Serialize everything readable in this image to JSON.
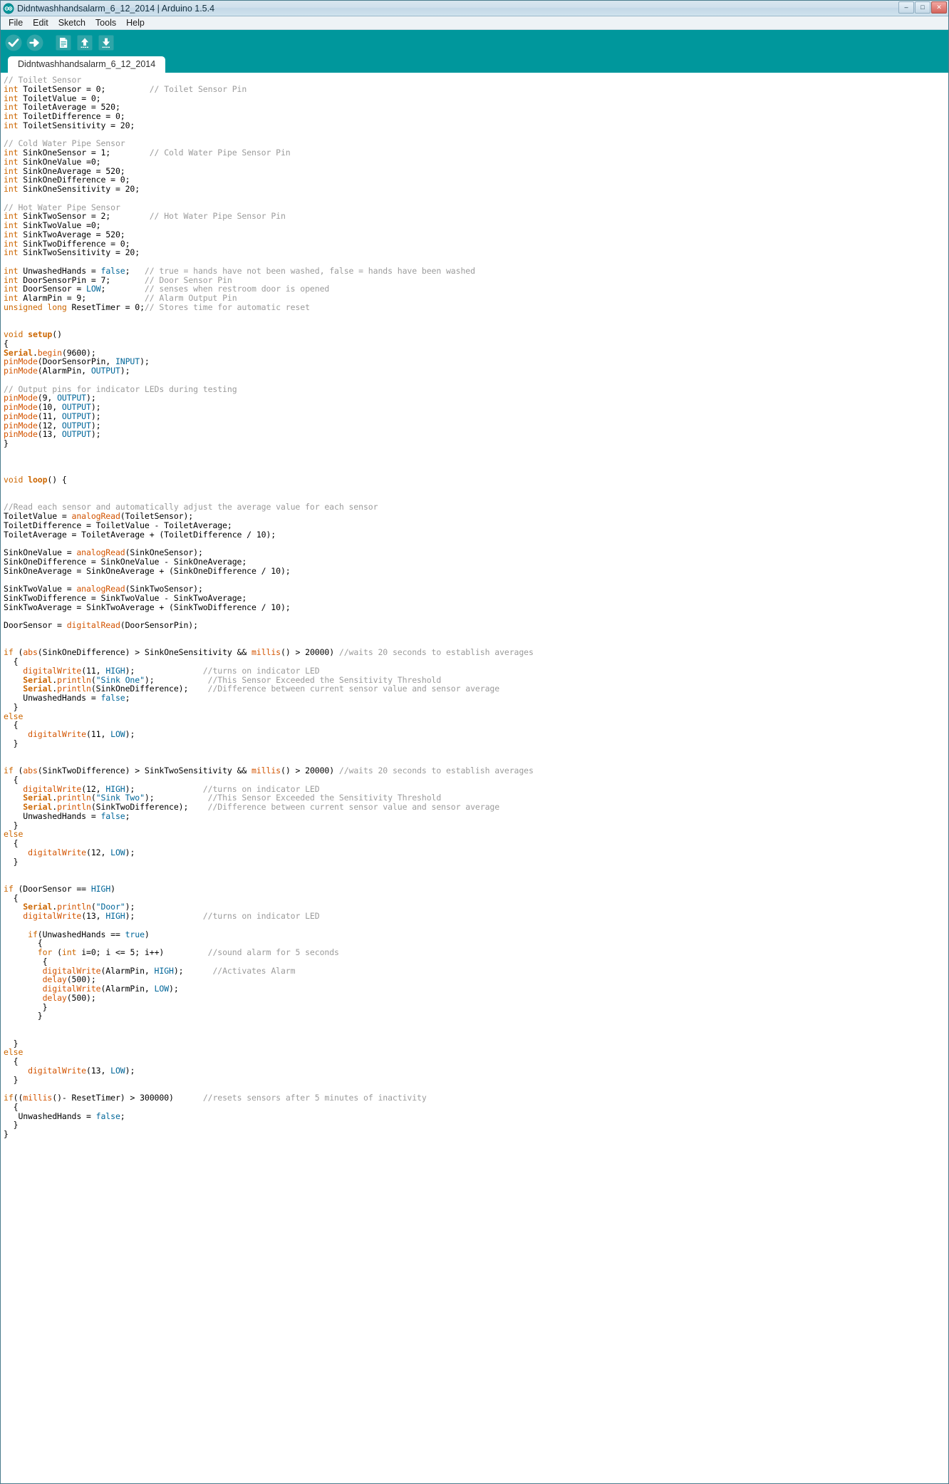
{
  "window": {
    "title": "Didntwashhandsalarm_6_12_2014 | Arduino 1.5.4",
    "app_icon": "arduino-infinity-icon",
    "minimize_label": "–",
    "maximize_label": "□",
    "close_label": "✕",
    "accent_color": "#00979C",
    "titlebar_color": "#CFE0EC"
  },
  "menu": {
    "items": [
      {
        "label": "File"
      },
      {
        "label": "Edit"
      },
      {
        "label": "Sketch"
      },
      {
        "label": "Tools"
      },
      {
        "label": "Help"
      }
    ]
  },
  "toolbar": {
    "buttons": [
      {
        "name": "verify-button",
        "icon": "checkmark-icon",
        "label": "Verify"
      },
      {
        "name": "upload-button",
        "icon": "arrow-right-icon",
        "label": "Upload"
      },
      {
        "name": "new-button",
        "icon": "new-document-icon",
        "label": "New"
      },
      {
        "name": "open-button",
        "icon": "arrow-up-icon",
        "label": "Open"
      },
      {
        "name": "save-button",
        "icon": "arrow-down-icon",
        "label": "Save"
      }
    ]
  },
  "tabs": [
    {
      "label": "Didntwashhandsalarm_6_12_2014",
      "active": true
    }
  ],
  "editor": {
    "language": "arduino-c",
    "colors": {
      "comment": "#9B9B9B",
      "keyword": "#CC6600",
      "function": "#D35400",
      "literal": "#006699",
      "string": "#006699",
      "plain": "#000000"
    },
    "code_lines": [
      "// Toilet Sensor",
      "int ToiletSensor = 0;         // Toilet Sensor Pin",
      "int ToiletValue = 0;",
      "int ToiletAverage = 520;",
      "int ToiletDifference = 0;",
      "int ToiletSensitivity = 20;",
      "",
      "// Cold Water Pipe Sensor",
      "int SinkOneSensor = 1;        // Cold Water Pipe Sensor Pin",
      "int SinkOneValue =0;",
      "int SinkOneAverage = 520;",
      "int SinkOneDifference = 0;",
      "int SinkOneSensitivity = 20;",
      "",
      "// Hot Water Pipe Sensor",
      "int SinkTwoSensor = 2;        // Hot Water Pipe Sensor Pin",
      "int SinkTwoValue =0;",
      "int SinkTwoAverage = 520;",
      "int SinkTwoDifference = 0;",
      "int SinkTwoSensitivity = 20;",
      "",
      "int UnwashedHands = false;   // true = hands have not been washed, false = hands have been washed",
      "int DoorSensorPin = 7;       // Door Sensor Pin",
      "int DoorSensor = LOW;        // senses when restroom door is opened",
      "int AlarmPin = 9;            // Alarm Output Pin",
      "unsigned long ResetTimer = 0;// Stores time for automatic reset",
      "",
      "",
      "void setup()",
      "{",
      "Serial.begin(9600);",
      "pinMode(DoorSensorPin, INPUT);",
      "pinMode(AlarmPin, OUTPUT);",
      "",
      "// Output pins for indicator LEDs during testing",
      "pinMode(9, OUTPUT);",
      "pinMode(10, OUTPUT);",
      "pinMode(11, OUTPUT);",
      "pinMode(12, OUTPUT);",
      "pinMode(13, OUTPUT);",
      "}",
      "",
      "",
      "",
      "void loop() {",
      "",
      "",
      "//Read each sensor and automatically adjust the average value for each sensor",
      "ToiletValue = analogRead(ToiletSensor);",
      "ToiletDifference = ToiletValue - ToiletAverage;",
      "ToiletAverage = ToiletAverage + (ToiletDifference / 10);",
      "",
      "SinkOneValue = analogRead(SinkOneSensor);",
      "SinkOneDifference = SinkOneValue - SinkOneAverage;",
      "SinkOneAverage = SinkOneAverage + (SinkOneDifference / 10);",
      "",
      "SinkTwoValue = analogRead(SinkTwoSensor);",
      "SinkTwoDifference = SinkTwoValue - SinkTwoAverage;",
      "SinkTwoAverage = SinkTwoAverage + (SinkTwoDifference / 10);",
      "",
      "DoorSensor = digitalRead(DoorSensorPin);",
      "",
      "",
      "if (abs(SinkOneDifference) > SinkOneSensitivity && millis() > 20000) //waits 20 seconds to establish averages",
      "  {",
      "    digitalWrite(11, HIGH);              //turns on indicator LED",
      "    Serial.println(\"Sink One\");           //This Sensor Exceeded the Sensitivity Threshold",
      "    Serial.println(SinkOneDifference);    //Difference between current sensor value and sensor average",
      "    UnwashedHands = false;",
      "  }",
      "else",
      "  {",
      "     digitalWrite(11, LOW);",
      "  }",
      "",
      "",
      "if (abs(SinkTwoDifference) > SinkTwoSensitivity && millis() > 20000) //waits 20 seconds to establish averages",
      "  {",
      "    digitalWrite(12, HIGH);              //turns on indicator LED",
      "    Serial.println(\"Sink Two\");           //This Sensor Exceeded the Sensitivity Threshold",
      "    Serial.println(SinkTwoDifference);    //Difference between current sensor value and sensor average",
      "    UnwashedHands = false;",
      "  }",
      "else",
      "  {",
      "     digitalWrite(12, LOW);",
      "  }",
      "",
      "",
      "if (DoorSensor == HIGH)",
      "  {",
      "    Serial.println(\"Door\");",
      "    digitalWrite(13, HIGH);              //turns on indicator LED",
      "",
      "     if(UnwashedHands == true)",
      "       {",
      "       for (int i=0; i <= 5; i++)         //sound alarm for 5 seconds",
      "        {",
      "        digitalWrite(AlarmPin, HIGH);      //Activates Alarm",
      "        delay(500);",
      "        digitalWrite(AlarmPin, LOW);",
      "        delay(500);",
      "        }",
      "       }",
      "",
      "",
      "  }",
      "else",
      "  {",
      "     digitalWrite(13, LOW);",
      "  }",
      "",
      "if((millis()- ResetTimer) > 300000)      //resets sensors after 5 minutes of inactivity",
      "  {",
      "   UnwashedHands = false;",
      "  }",
      "}"
    ]
  }
}
